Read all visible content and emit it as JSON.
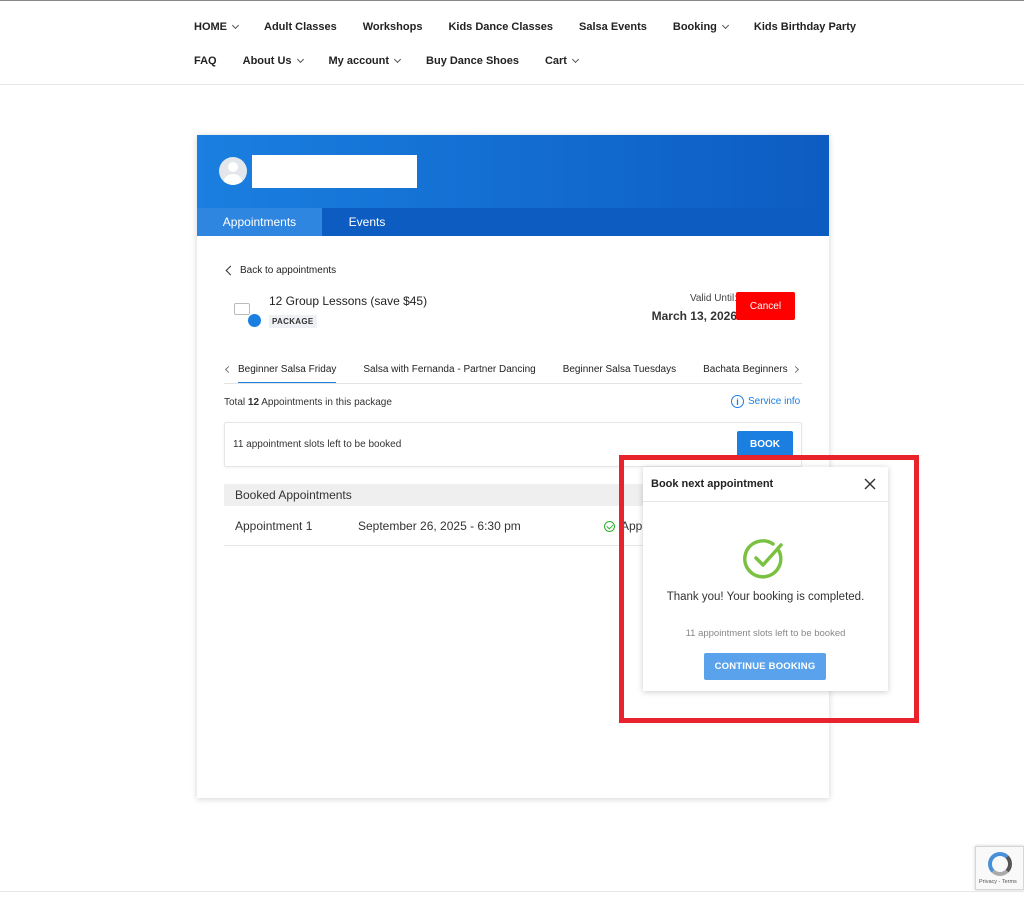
{
  "nav": {
    "row1": [
      {
        "label": "HOME",
        "dropdown": true
      },
      {
        "label": "Adult Classes",
        "dropdown": false
      },
      {
        "label": "Workshops",
        "dropdown": false
      },
      {
        "label": "Kids Dance Classes",
        "dropdown": false
      },
      {
        "label": "Salsa Events",
        "dropdown": false
      },
      {
        "label": "Booking",
        "dropdown": true
      },
      {
        "label": "Kids Birthday Party",
        "dropdown": false
      }
    ],
    "row2": [
      {
        "label": "FAQ",
        "dropdown": false
      },
      {
        "label": "About Us",
        "dropdown": true
      },
      {
        "label": "My account",
        "dropdown": true
      },
      {
        "label": "Buy Dance Shoes",
        "dropdown": false
      },
      {
        "label": "Cart",
        "dropdown": true
      }
    ]
  },
  "colors": {
    "accent": "#1a7fe0",
    "header_dark": "#0d5cc2",
    "cancel": "#ff0000",
    "success": "#7ac142",
    "highlight": "#e8232b"
  },
  "card": {
    "tabs": [
      {
        "label": "Appointments",
        "active": true
      },
      {
        "label": "Events",
        "active": false
      }
    ],
    "back_label": "Back to appointments",
    "package": {
      "title": "12 Group Lessons (save $45)",
      "badge": "PACKAGE",
      "valid_label": "Valid Until:",
      "valid_date": "March 13, 2026",
      "cancel_label": "Cancel"
    },
    "service_tabs": [
      {
        "label": "Beginner Salsa Friday",
        "active": true
      },
      {
        "label": "Salsa with Fernanda - Partner Dancing",
        "active": false
      },
      {
        "label": "Beginner Salsa Tuesdays",
        "active": false
      },
      {
        "label": "Bachata Beginners Th",
        "active": false
      }
    ],
    "total": {
      "prefix": "Total ",
      "count": "12",
      "suffix": " Appointments in this package"
    },
    "service_info_label": "Service info",
    "slots_text": "11 appointment slots left to be booked",
    "book_label": "BOOK",
    "booked_header": "Booked Appointments",
    "appointments": [
      {
        "name": "Appointment 1",
        "date": "September 26, 2025 - 6:30 pm",
        "status": "App"
      }
    ]
  },
  "popup": {
    "title": "Book next appointment",
    "message": "Thank you! Your booking is completed.",
    "sub": "11 appointment slots left to be booked",
    "continue_label": "CONTINUE BOOKING"
  },
  "recaptcha": {
    "text": "Privacy - Terms"
  }
}
